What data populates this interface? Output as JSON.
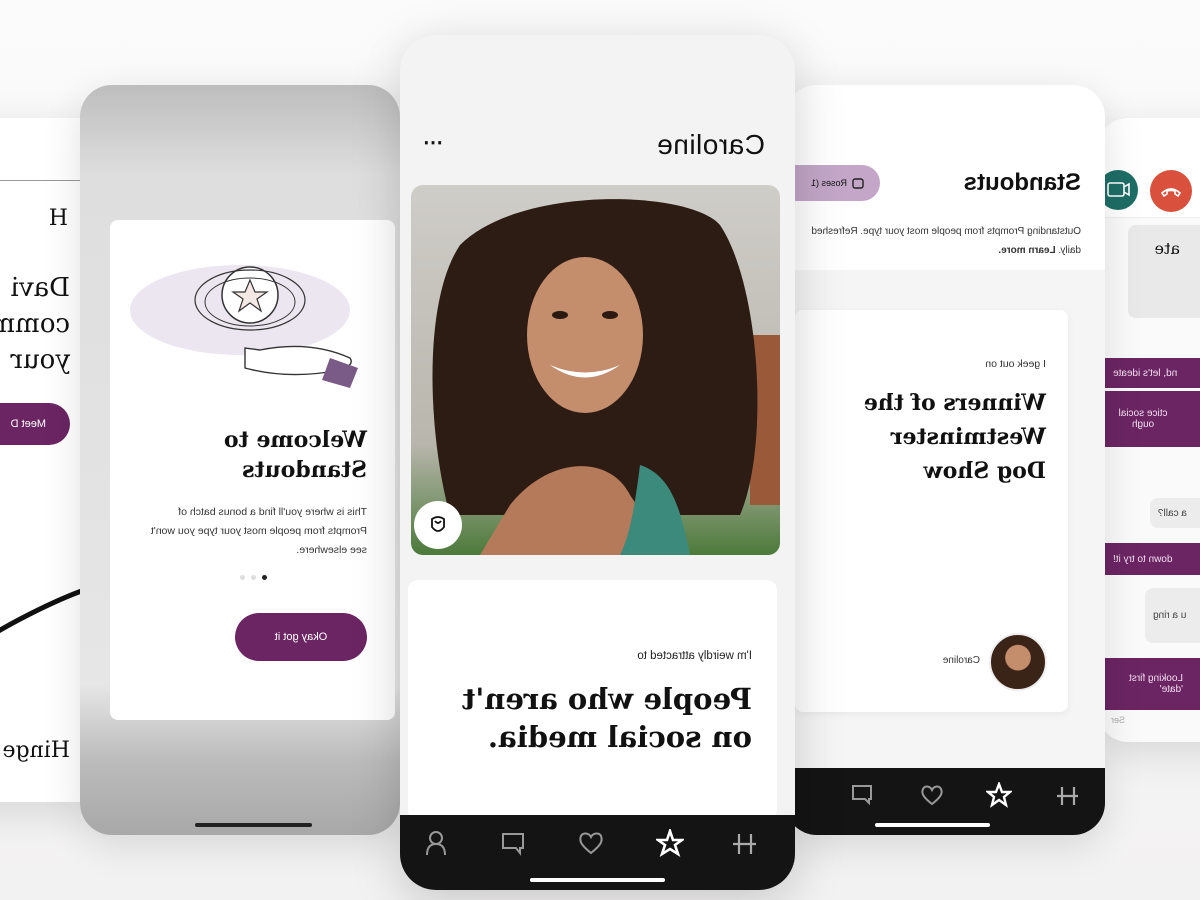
{
  "brand": {
    "accent": "#6b2563",
    "rose_pill": "#c3a6c8",
    "nav_bg": "#141414",
    "end_call": "#d9503c",
    "video_call": "#1e6e66"
  },
  "home_screen": {
    "logo": "H",
    "headline_lines": [
      "Davi",
      "comm",
      "your"
    ],
    "button_label": "Meet D",
    "footer_brand": "Hinge"
  },
  "welcome_screen": {
    "title": "Welcome to Standouts",
    "body": "This is where you'll find a bonus batch of Prompts from people most your type you won't see elsewhere.",
    "pager": {
      "count": 3,
      "active": 1
    },
    "button_label": "Okay got it",
    "illustration": "hand-holding-star-icon"
  },
  "profile_screen": {
    "name": "Caroline",
    "more_icon": "ellipsis-icon",
    "photo_action_icon": "rose-icon",
    "prompt": {
      "question": "I'm weirdly attracted to",
      "answer": "People who aren't on social media."
    },
    "nav": [
      "hinge-logo-icon",
      "star-icon",
      "heart-icon",
      "chat-icon",
      "person-icon"
    ],
    "nav_active": "star-icon"
  },
  "standouts_screen": {
    "title": "Standouts",
    "roses_label": "Roses (1",
    "subtitle": "Outstanding Prompts from people most your type. Refreshed daily.",
    "learn_more": "Learn more.",
    "card": {
      "question": "I geek out on",
      "answer": "Winners of the Westminster Dog Show",
      "name": "Caroline"
    },
    "nav_active": "star-icon"
  },
  "chat_screen": {
    "top_card_text": "ate",
    "messages": [
      {
        "type": "sent",
        "text": "nd, let's ideate"
      },
      {
        "type": "sent",
        "text": "ctice social ough"
      },
      {
        "type": "recv",
        "text": "a call?"
      },
      {
        "type": "sent",
        "text": "down to try it!"
      },
      {
        "type": "recv",
        "text": "u a ring"
      },
      {
        "type": "sent",
        "text": "Looking first 'date'"
      }
    ],
    "footer_text": "Ser"
  }
}
